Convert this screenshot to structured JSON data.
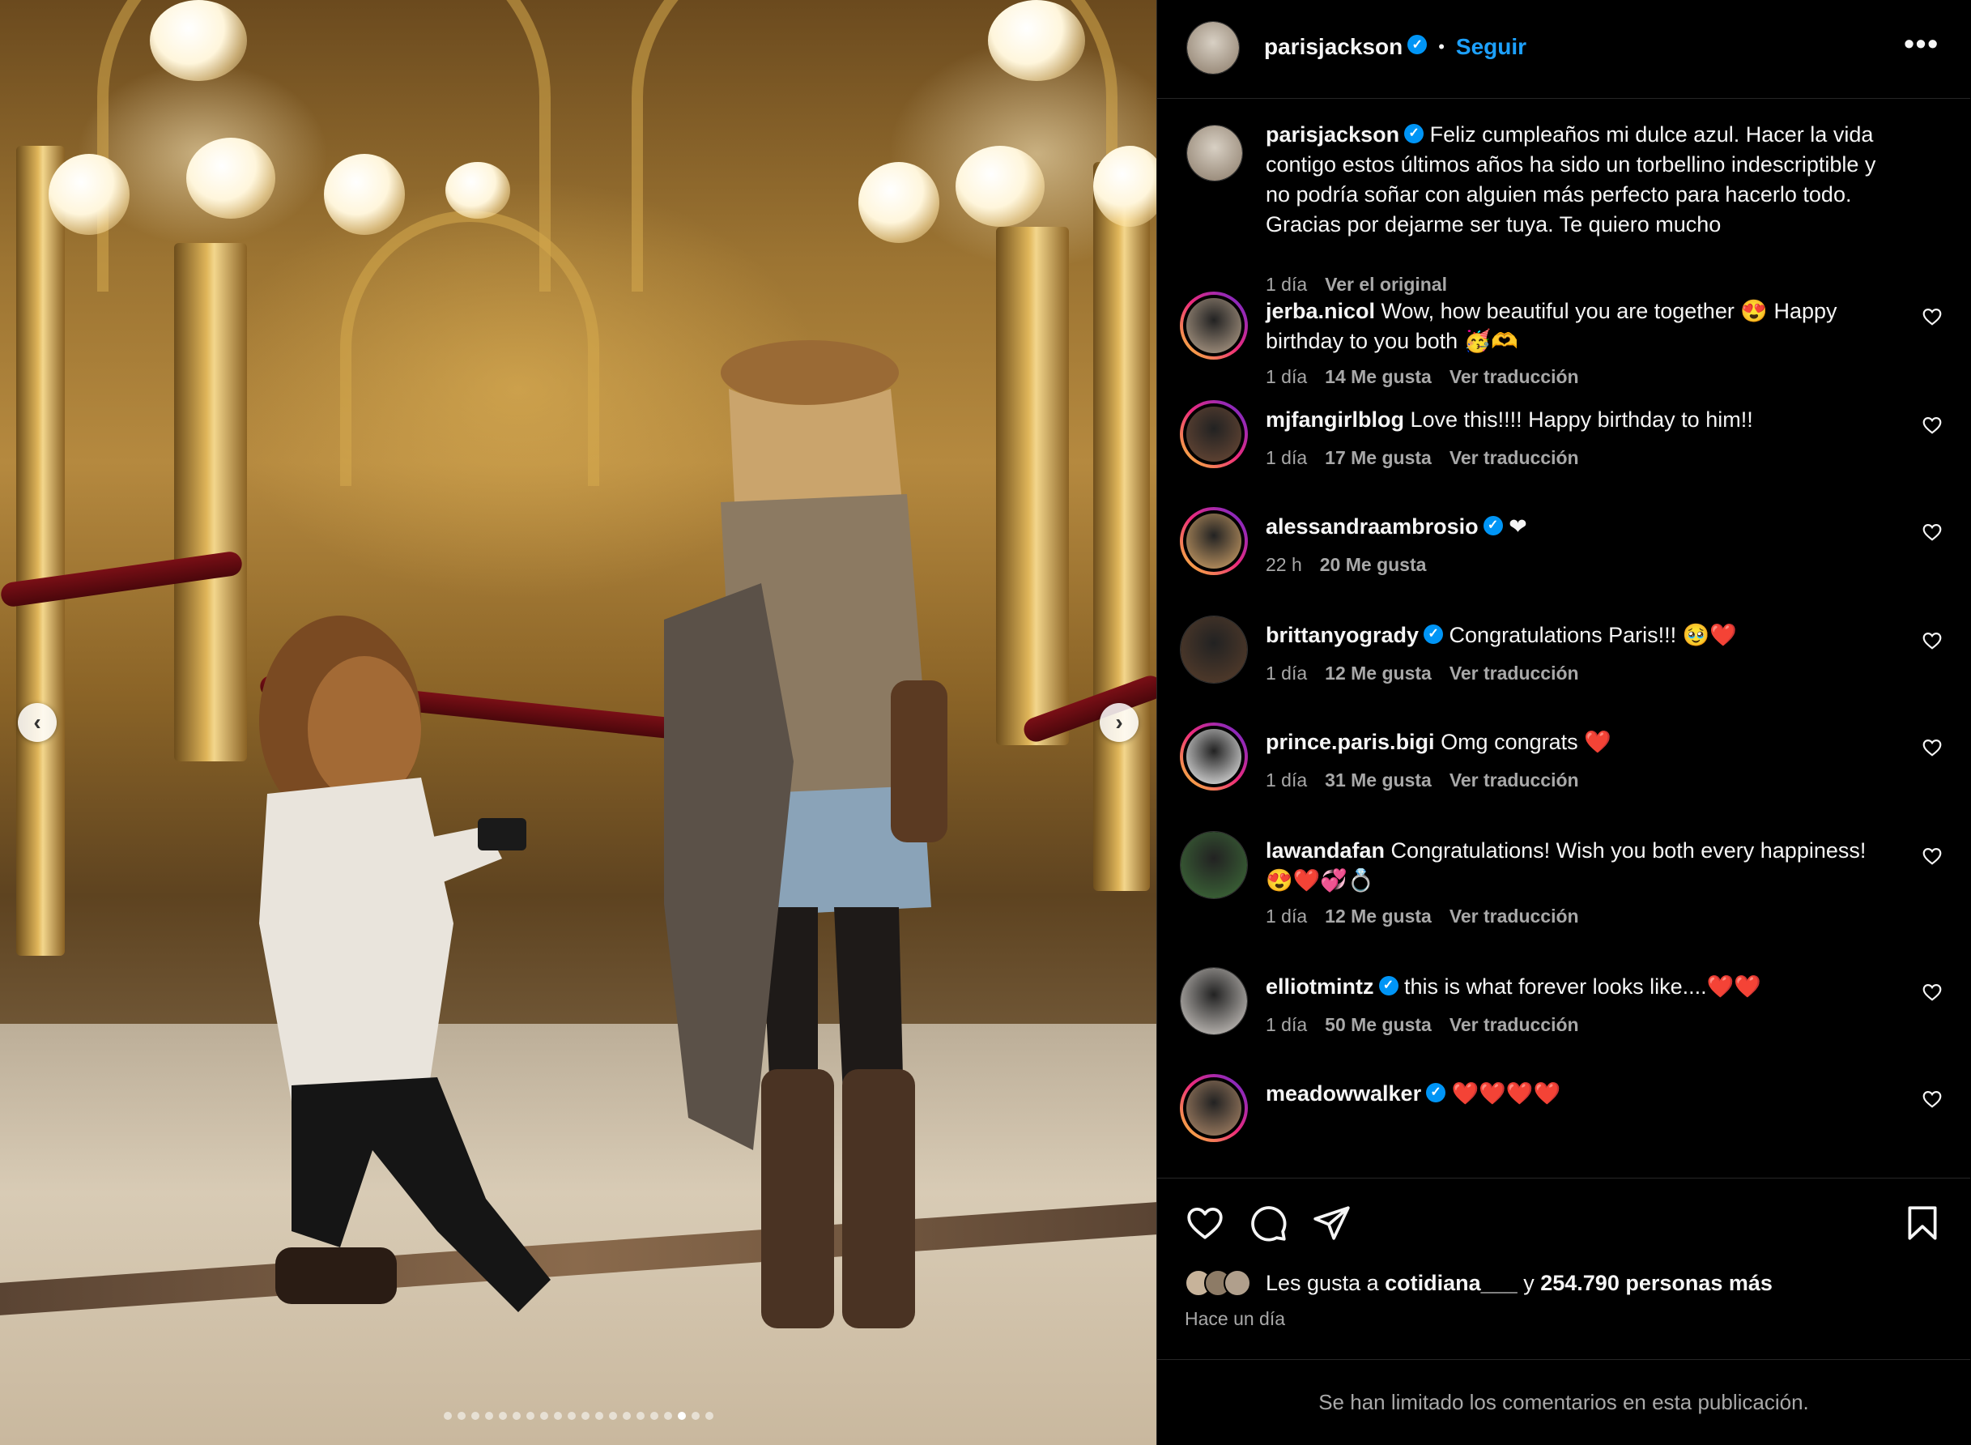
{
  "post": {
    "username": "parisjackson",
    "follow_label": "Seguir",
    "image_alt": "Proposal in an ornate golden hall",
    "carousel": {
      "total_slides": 20,
      "active_index": 17
    }
  },
  "caption": {
    "username": "parisjackson",
    "text": "Feliz cumpleaños mi dulce azul. Hacer la vida contigo estos últimos años ha sido un torbellino indescriptible y no podría soñar con alguien más perfecto para hacerlo todo. Gracias por dejarme ser tuya. Te quiero mucho",
    "time": "1 día",
    "original_link": "Ver el original"
  },
  "comments": [
    {
      "username": "jerba.nicol",
      "verified": false,
      "text": "Wow, how beautiful you are together 😍 Happy birthday to you both 🥳🫶",
      "time": "1 día",
      "likes": "14 Me gusta",
      "translate": "Ver traducción",
      "avatar_color": "#b9a48e",
      "ring": true
    },
    {
      "username": "mjfangirlblog",
      "verified": false,
      "text": "Love this!!!! Happy birthday to him!!",
      "time": "1 día",
      "likes": "17 Me gusta",
      "translate": "Ver traducción",
      "avatar_color": "#6d4a36",
      "ring": true
    },
    {
      "username": "alessandraambrosio",
      "verified": true,
      "text": "❤",
      "time": "22 h",
      "likes": "20 Me gusta",
      "translate": "",
      "avatar_color": "#d4a56a",
      "ring": true
    },
    {
      "username": "brittanyogrady",
      "verified": true,
      "text": "Congratulations Paris!!! 🥹❤️",
      "time": "1 día",
      "likes": "12 Me gusta",
      "translate": "Ver traducción",
      "avatar_color": "#5a3f2c",
      "ring": false
    },
    {
      "username": "prince.paris.bigi",
      "verified": false,
      "text": "Omg congrats ❤️",
      "time": "1 día",
      "likes": "31 Me gusta",
      "translate": "Ver traducción",
      "avatar_color": "#f2f2f2",
      "ring": true
    },
    {
      "username": "lawandafan",
      "verified": false,
      "text": "Congratulations! Wish you both every happiness! 😍❤️💞💍",
      "time": "1 día",
      "likes": "12 Me gusta",
      "translate": "Ver traducción",
      "avatar_color": "#3f6f3a",
      "ring": false
    },
    {
      "username": "elliotmintz",
      "verified": true,
      "text": "this is what forever looks like....❤️❤️",
      "time": "1 día",
      "likes": "50 Me gusta",
      "translate": "Ver traducción",
      "avatar_color": "#d9d4cf",
      "ring": false
    },
    {
      "username": "meadowwalker",
      "verified": true,
      "text": "❤️❤️❤️❤️",
      "time": "",
      "likes": "",
      "translate": "",
      "avatar_color": "#b08a6a",
      "ring": true
    }
  ],
  "actions": {
    "likes_prefix": "Les gusta a",
    "likes_user": "cotidiana___",
    "likes_join": "y",
    "likes_count": "254.790 personas más",
    "timestamp": "Hace un día"
  },
  "comments_limited": "Se han limitado los comentarios en esta publicación.",
  "colors": {
    "accent": "#0095f6",
    "follow": "#1da1ff",
    "muted": "#a8a8a8",
    "bg": "#000000"
  },
  "icons": [
    "chevron-left-icon",
    "chevron-right-icon",
    "more-icon",
    "verified-icon",
    "heart-icon",
    "comment-icon",
    "share-icon",
    "bookmark-icon"
  ]
}
